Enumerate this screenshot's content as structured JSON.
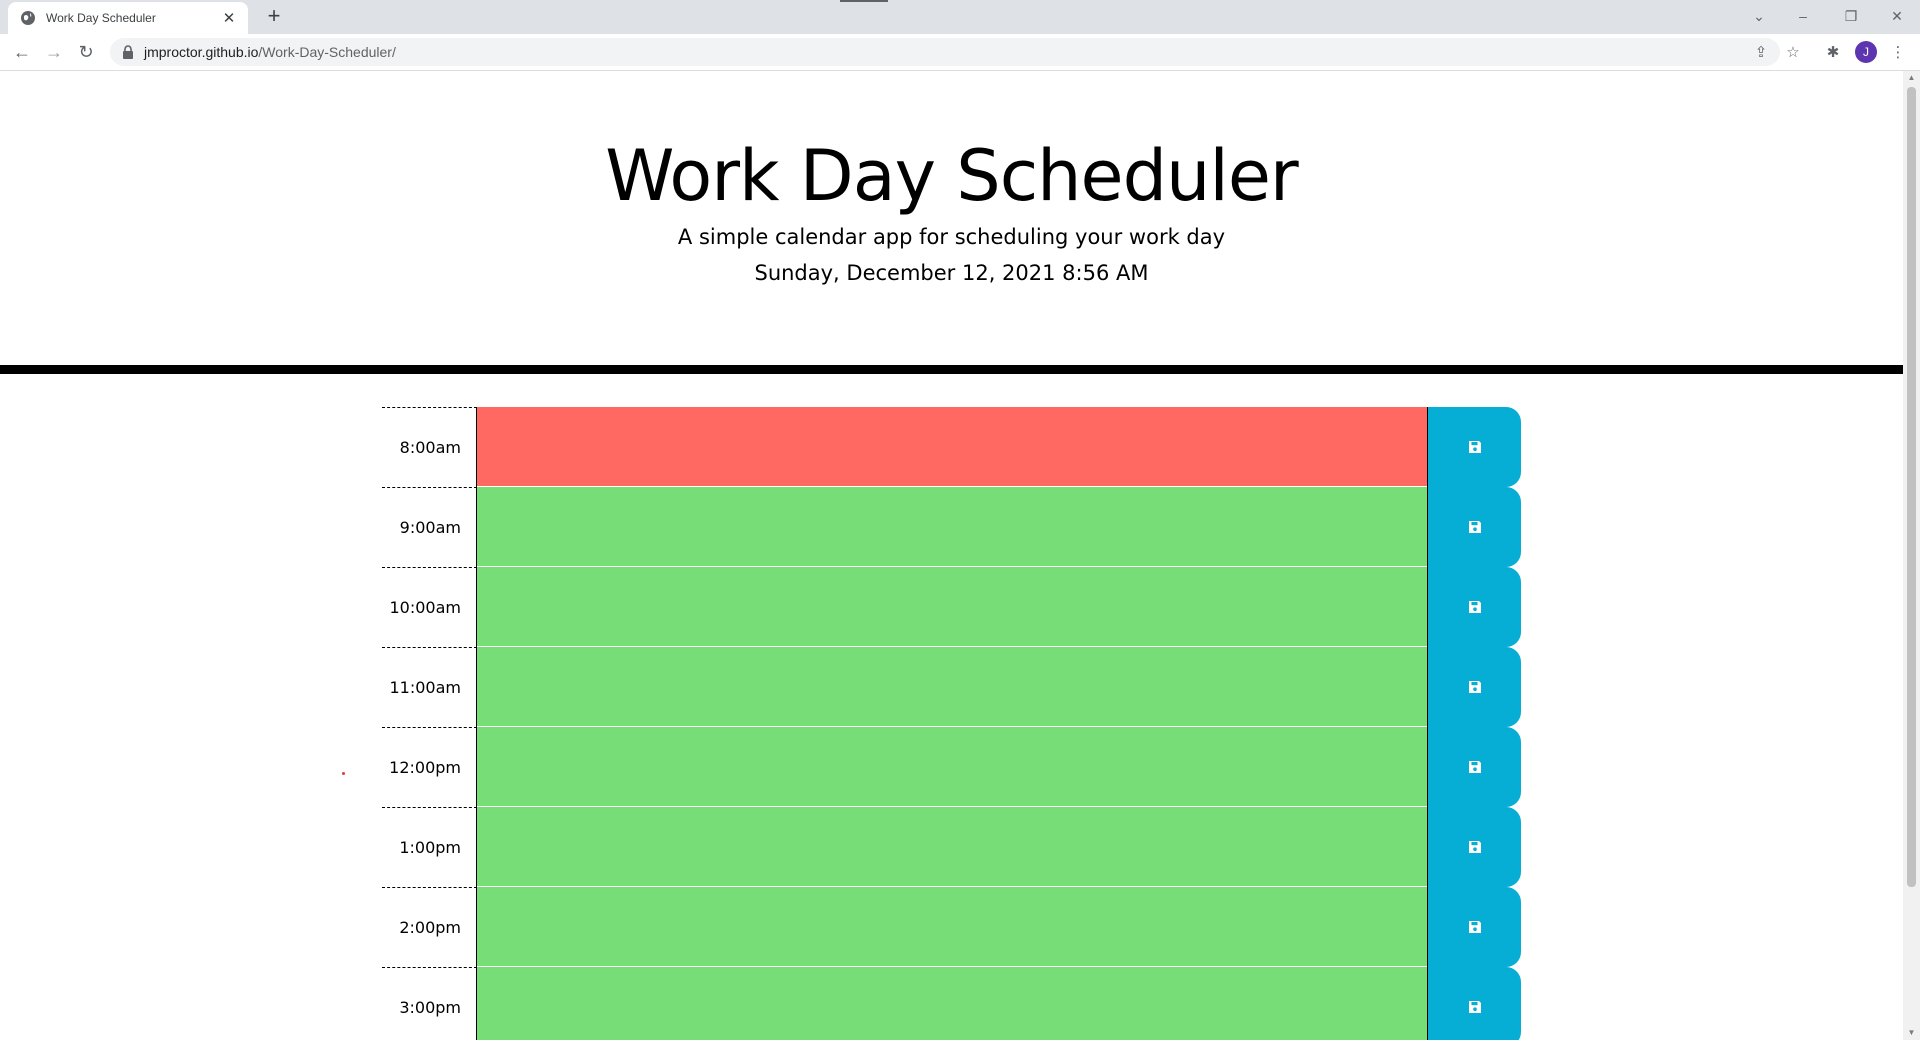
{
  "browser": {
    "tab_title": "Work Day Scheduler",
    "url_host": "jmproctor.github.io",
    "url_path": "/Work-Day-Scheduler/",
    "profile_initial": "J",
    "icons": [
      "globe-icon",
      "close-icon",
      "plus-icon",
      "back-icon",
      "forward-icon",
      "reload-icon",
      "lock-icon",
      "share-icon",
      "star-icon",
      "puzzle-icon",
      "kebab-menu-icon"
    ]
  },
  "header": {
    "title": "Work Day Scheduler",
    "lead": "A simple calendar app for scheduling your work day",
    "current_day": "Sunday, December 12, 2021 8:56 AM"
  },
  "colors": {
    "past": "#d3d3d3",
    "present": "#ff6961",
    "future": "#77dd77",
    "save_button": "#06aed5"
  },
  "schedule": {
    "rows": [
      {
        "hour": "8:00am",
        "state": "present",
        "text": ""
      },
      {
        "hour": "9:00am",
        "state": "future",
        "text": ""
      },
      {
        "hour": "10:00am",
        "state": "future",
        "text": ""
      },
      {
        "hour": "11:00am",
        "state": "future",
        "text": ""
      },
      {
        "hour": "12:00pm",
        "state": "future",
        "text": ""
      },
      {
        "hour": "1:00pm",
        "state": "future",
        "text": ""
      },
      {
        "hour": "2:00pm",
        "state": "future",
        "text": ""
      },
      {
        "hour": "3:00pm",
        "state": "future",
        "text": ""
      }
    ]
  }
}
